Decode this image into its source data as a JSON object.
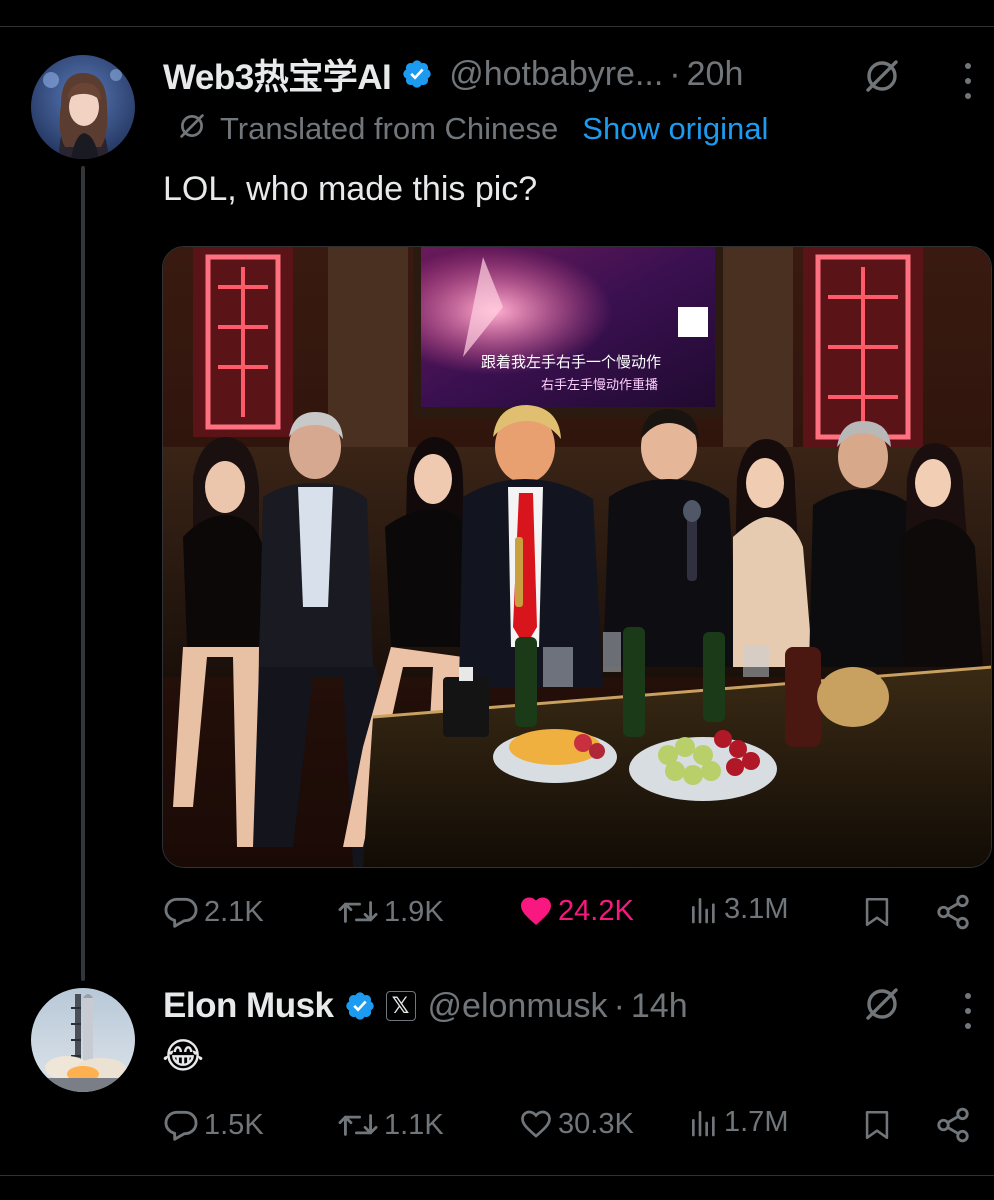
{
  "tweet1": {
    "display_name": "Web3热宝学AI",
    "handle": "@hotbabyre...",
    "time": "20h",
    "translated_label": "Translated from Chinese",
    "show_original_label": "Show original",
    "text": "LOL, who made this pic?",
    "image": {
      "subtitle_line1": "跟着我左手右手一个慢动作",
      "subtitle_line2": "右手左手慢动作重播"
    },
    "stats": {
      "replies": "2.1K",
      "reposts": "1.9K",
      "likes": "24.2K",
      "views": "3.1M"
    },
    "liked": true
  },
  "tweet2": {
    "display_name": "Elon Musk",
    "handle": "@elonmusk",
    "time": "14h",
    "text": "😂",
    "stats": {
      "replies": "1.5K",
      "reposts": "1.1K",
      "likes": "30.3K",
      "views": "1.7M"
    },
    "liked": false
  },
  "separator": "·",
  "x_badge_glyph": "𝕏",
  "icons": {
    "verified": "verified-badge-icon",
    "grok": "grok-slash-icon",
    "more": "more-vertical-icon",
    "reply": "reply-icon",
    "repost": "repost-icon",
    "like": "heart-icon",
    "views": "views-icon",
    "bookmark": "bookmark-icon",
    "share": "share-icon"
  },
  "colors": {
    "background": "#000000",
    "text": "#e7e9ea",
    "muted": "#71767b",
    "link": "#1d9bf0",
    "like": "#f91880",
    "verified": "#1d9bf0"
  }
}
